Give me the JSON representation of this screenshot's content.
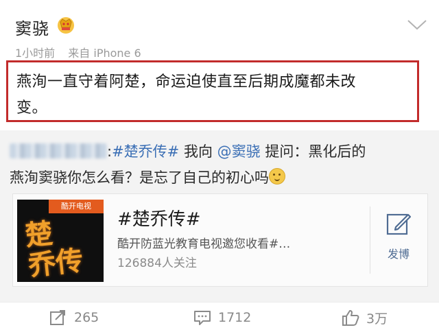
{
  "post": {
    "username": "窦骁",
    "time": "1小时前",
    "source": "来自 iPhone 6",
    "text_line1": "燕洵一直守着阿楚，命运迫使直至后期成魔都未改",
    "text_line2": "变。"
  },
  "repost": {
    "hashtag": "#楚乔传#",
    "word_me": " 我向 ",
    "mention": "@窦骁",
    "ask_prefix": " 提问：",
    "question_part1": "黑化后的",
    "question_part2": "燕洵窦骁你怎么看？是忘了自己的初心吗"
  },
  "card": {
    "brand_label": "酷开电视",
    "title": "#楚乔传#",
    "description": "酷开防蓝光教育电视邀您收看#…",
    "followers": "126884人关注",
    "post_label": "发博"
  },
  "actions": {
    "repost_count": "265",
    "comment_count": "1712",
    "like_count": "3万"
  },
  "colors": {
    "highlight_border": "#c22b2b",
    "link": "#3b6fb5",
    "repost_bg": "#f3f3f3"
  },
  "icons": [
    "crown-icon",
    "chevron-down-icon",
    "smile-emoji-icon",
    "compose-icon",
    "repost-icon",
    "comment-icon",
    "like-icon"
  ]
}
